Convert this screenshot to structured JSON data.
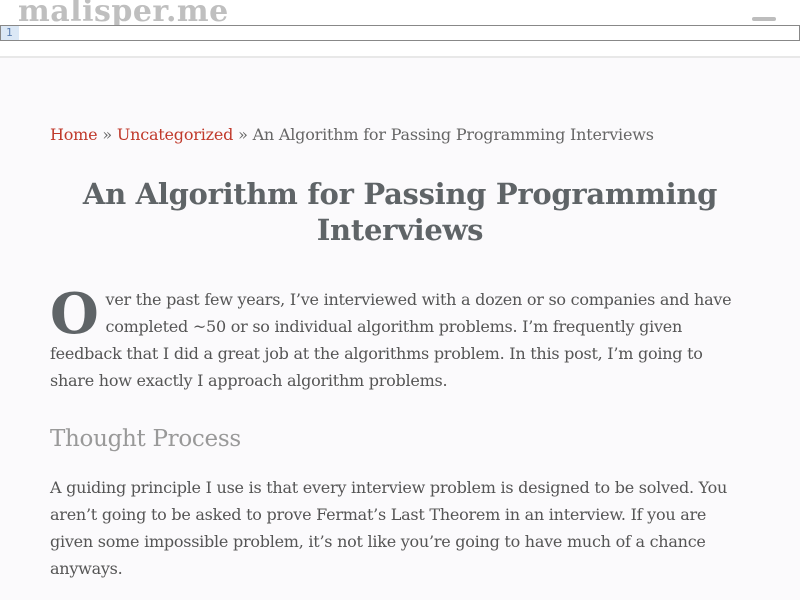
{
  "header": {
    "site_name": "malisper.me"
  },
  "editor": {
    "line_number": "1"
  },
  "breadcrumb": {
    "home": "Home",
    "separator": "»",
    "category": "Uncategorized",
    "current": "An Algorithm for Passing Programming Interviews"
  },
  "article": {
    "title": "An Algorithm for Passing Programming Interviews",
    "dropcap": "O",
    "intro": "ver the past few years, I’ve interviewed with a dozen or so companies and have completed ~50 or so individual algorithm problems. I’m frequently given feedback that I did a great job at the algorithms problem. In this post, I’m going to share how exactly I approach algorithm problems.",
    "section_heading": "Thought Process",
    "paragraph": "A guiding principle I use is that every interview problem is designed to be solved. You aren’t going to be asked to prove Fermat’s Last Theorem in an interview. If you are given some impossible problem, it’s not like you’re going to have much of a chance anyways."
  },
  "icons": {
    "menu": "hamburger-menu-icon"
  }
}
